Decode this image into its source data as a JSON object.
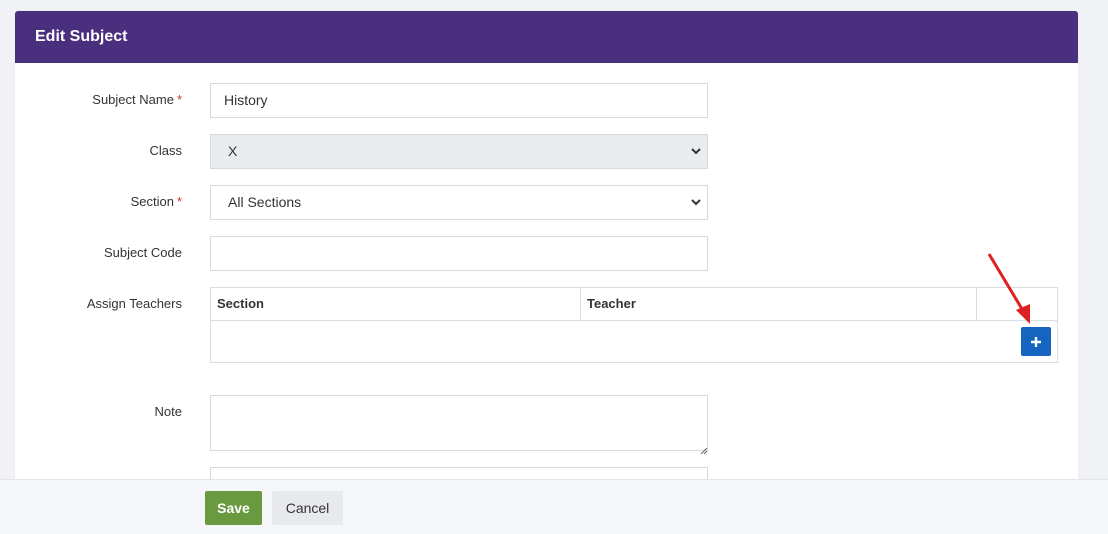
{
  "header": {
    "title": "Edit Subject"
  },
  "form": {
    "subject_name": {
      "label": "Subject Name",
      "required": "*",
      "value": "History"
    },
    "class": {
      "label": "Class",
      "value": "X"
    },
    "section": {
      "label": "Section",
      "required": "*",
      "value": "All Sections"
    },
    "subject_code": {
      "label": "Subject Code",
      "value": ""
    },
    "assign_teachers": {
      "label": "Assign Teachers",
      "columns": [
        "Section",
        "Teacher"
      ],
      "add_icon": "plus-icon"
    },
    "note": {
      "label": "Note",
      "value": ""
    }
  },
  "footer": {
    "save_label": "Save",
    "cancel_label": "Cancel"
  },
  "colors": {
    "header_bg": "#4a2f7e",
    "save_bg": "#6a9a3f",
    "add_button_bg": "#1565c0",
    "annotation_arrow": "#e02020"
  }
}
